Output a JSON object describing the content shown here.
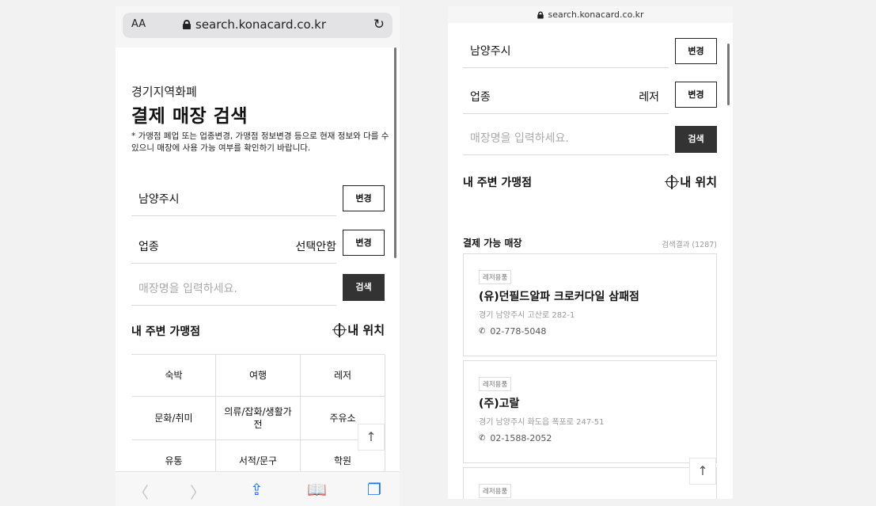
{
  "left": {
    "text_size_btn": "AA",
    "url": "search.konacard.co.kr",
    "subtitle": "경기지역화폐",
    "title": "결제 매장 검색",
    "note": "* 가맹점 폐업 또는 업종변경, 가맹점 정보변경 등으로 현재 정보와 다를 수 있으니 매장에 사용 가능 여부를 확인하기 바랍니다.",
    "region": "남양주시",
    "change_btn": "변경",
    "category_label": "업종",
    "category_value": "선택안함",
    "search_placeholder": "매장명을 입력하세요.",
    "search_btn": "검색",
    "nearby_title": "내 주변 가맹점",
    "my_location": "내 위치",
    "categories": [
      "숙박",
      "여행",
      "레저",
      "문화/취미",
      "의류/잡화/생활가전",
      "주유소",
      "유통",
      "서적/문구",
      "학원"
    ],
    "to_top": "↑"
  },
  "right": {
    "url": "search.konacard.co.kr",
    "region": "남양주시",
    "change_btn": "변경",
    "category_label": "업종",
    "category_value": "레저",
    "search_placeholder": "매장명을 입력하세요.",
    "search_btn": "검색",
    "nearby_title": "내 주변 가맹점",
    "my_location": "내 위치",
    "results_title": "결제 가능 매장",
    "results_count": "검색결과 (1287)",
    "stores": [
      {
        "tag": "레저용품",
        "name": "(유)던필드알파 크로커다일 삼패점",
        "address": "경기 남양주시 고산로 282-1",
        "phone": "02-778-5048"
      },
      {
        "tag": "레저용품",
        "name": "(주)고랄",
        "address": "경기 남양주시 화도읍 폭포로 247-51",
        "phone": "02-1588-2052"
      },
      {
        "tag": "레저용품"
      }
    ],
    "to_top": "↑"
  }
}
